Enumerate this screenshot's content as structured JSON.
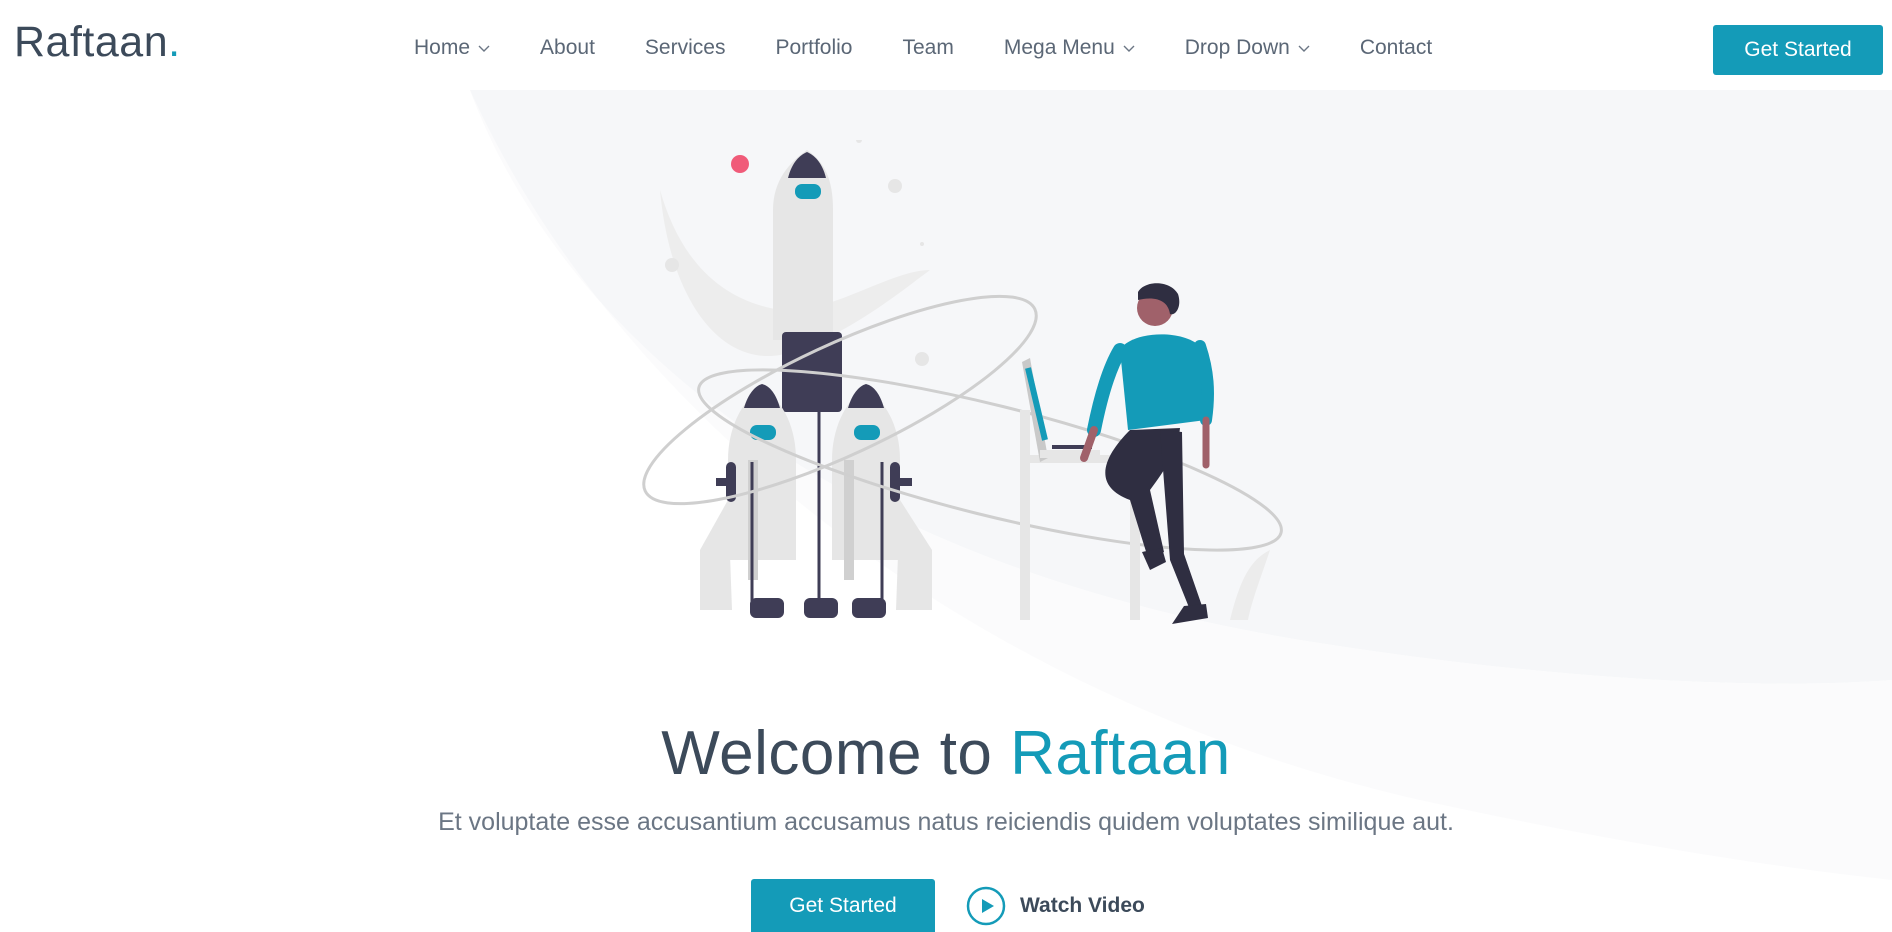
{
  "brand": {
    "name": "Raftaan",
    "dot": ".",
    "accent_color": "#149bb8"
  },
  "nav": {
    "items": [
      {
        "label": "Home",
        "has_dropdown": true
      },
      {
        "label": "About",
        "has_dropdown": false
      },
      {
        "label": "Services",
        "has_dropdown": false
      },
      {
        "label": "Portfolio",
        "has_dropdown": false
      },
      {
        "label": "Team",
        "has_dropdown": false
      },
      {
        "label": "Mega Menu",
        "has_dropdown": true
      },
      {
        "label": "Drop Down",
        "has_dropdown": true
      },
      {
        "label": "Contact",
        "has_dropdown": false
      }
    ],
    "cta_label": "Get Started"
  },
  "hero": {
    "title_prefix": "Welcome to ",
    "title_accent": "Raftaan",
    "subtitle": "Et voluptate esse accusantium accusamus natus reiciendis quidem voluptates similique aut.",
    "cta_label": "Get Started",
    "video_label": "Watch Video",
    "illustration_icon": "rocket-launch-illustration",
    "play_icon": "play-circle-icon"
  }
}
